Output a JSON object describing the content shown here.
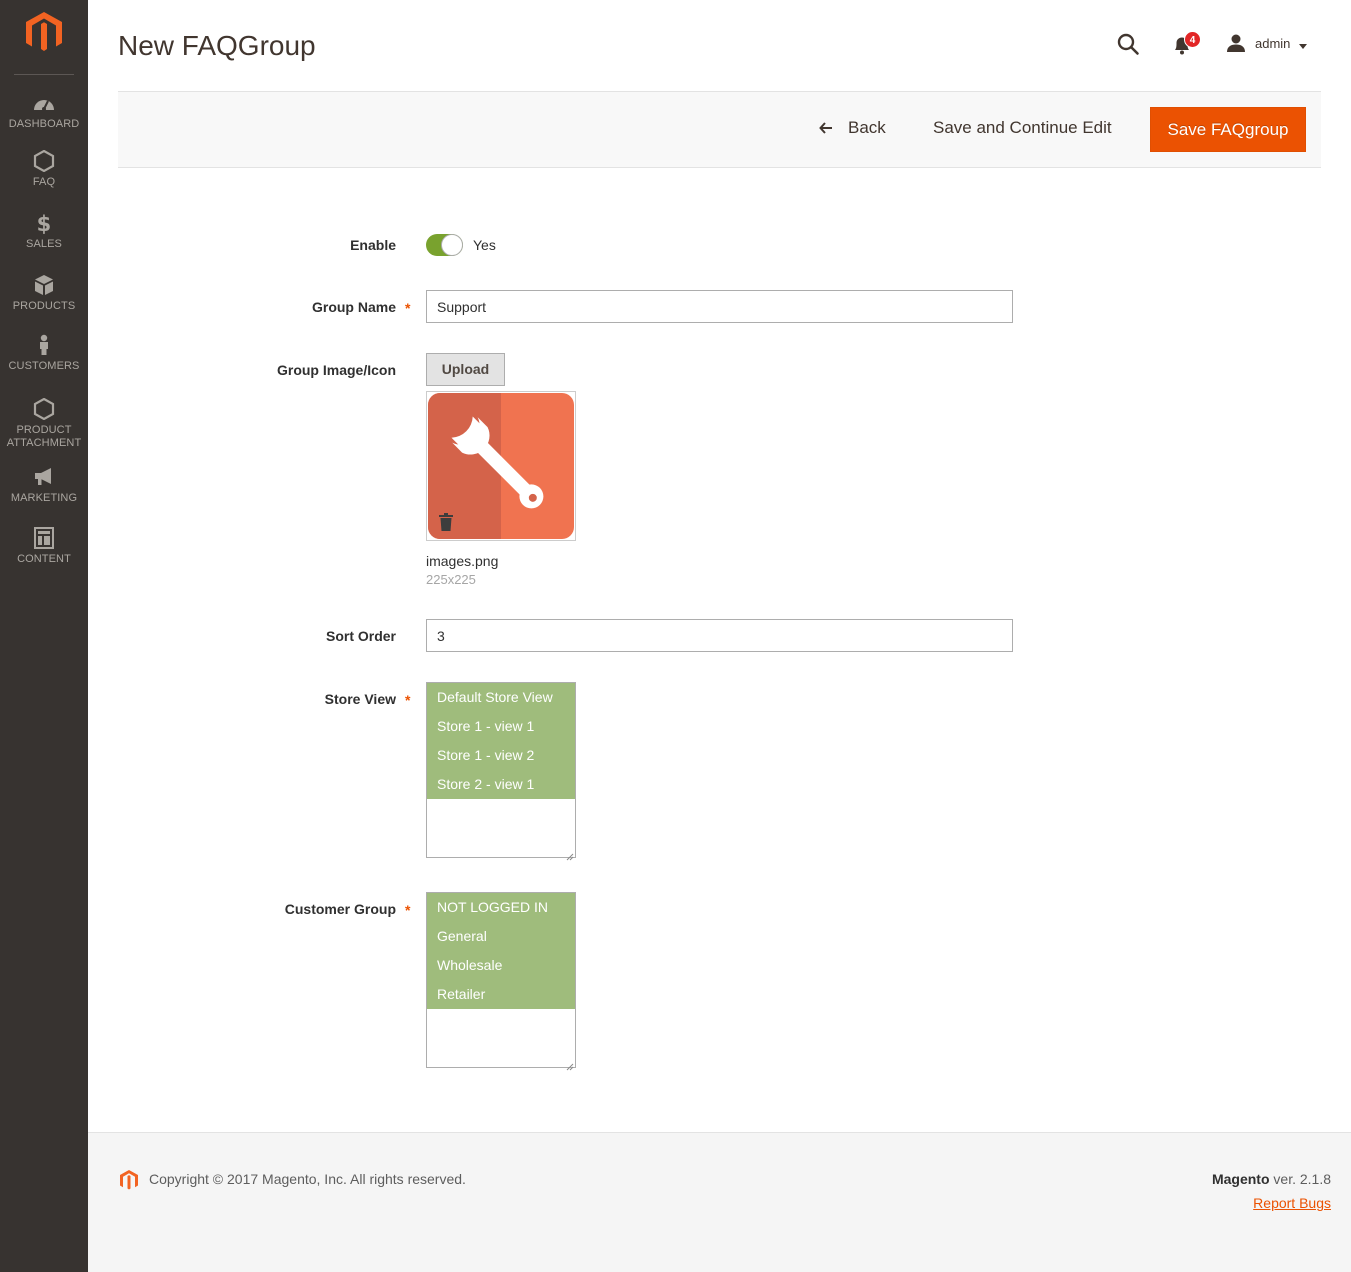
{
  "colors": {
    "sidebar_bg": "#373330",
    "accent": "#eb5202",
    "toggle_on": "#79a22e",
    "multiselect_selected": "#9fbc7c"
  },
  "sidebar": {
    "items": [
      {
        "label": "Dashboard",
        "icon": "dashboard-icon"
      },
      {
        "label": "FAQ",
        "icon": "hexagon-icon"
      },
      {
        "label": "Sales",
        "icon": "dollar-icon"
      },
      {
        "label": "Products",
        "icon": "cube-icon"
      },
      {
        "label": "Customers",
        "icon": "person-icon"
      },
      {
        "label": "Product Attachment",
        "icon": "hexagon-icon"
      },
      {
        "label": "Marketing",
        "icon": "megaphone-icon"
      },
      {
        "label": "Content",
        "icon": "layout-icon"
      }
    ]
  },
  "header": {
    "title": "New FAQGroup",
    "notifications_count": "4",
    "user_name": "admin"
  },
  "actions": {
    "back_label": "Back",
    "save_continue_label": "Save and Continue Edit",
    "save_label": "Save FAQgroup"
  },
  "form": {
    "enable": {
      "label": "Enable",
      "value_text": "Yes",
      "on": true
    },
    "group_name": {
      "label": "Group Name",
      "value": "Support",
      "required": "*"
    },
    "group_image": {
      "label": "Group Image/Icon",
      "upload_label": "Upload",
      "file_name": "images.png",
      "file_dims": "225x225"
    },
    "sort_order": {
      "label": "Sort Order",
      "value": "3"
    },
    "store_view": {
      "label": "Store View",
      "required": "*",
      "options": [
        "Default Store View",
        "Store 1 - view 1",
        "Store 1 - view 2",
        "Store 2 - view 1"
      ]
    },
    "customer_group": {
      "label": "Customer Group",
      "required": "*",
      "options": [
        "NOT LOGGED IN",
        "General",
        "Wholesale",
        "Retailer"
      ]
    }
  },
  "footer": {
    "copyright": "Copyright © 2017 Magento, Inc. All rights reserved.",
    "brand": "Magento",
    "version": " ver. 2.1.8",
    "report_bugs": "Report Bugs"
  }
}
